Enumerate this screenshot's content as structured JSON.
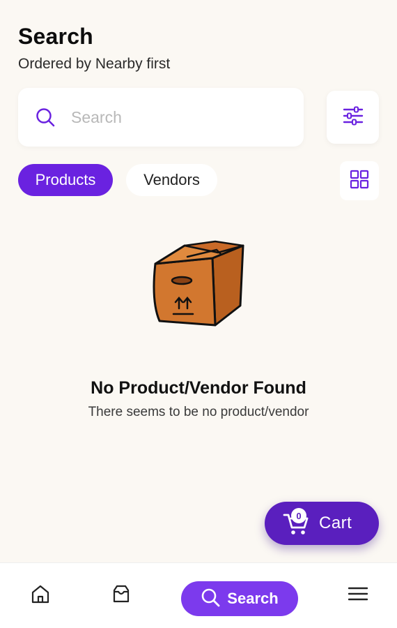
{
  "header": {
    "title": "Search",
    "subtitle": "Ordered by Nearby first"
  },
  "search": {
    "placeholder": "Search",
    "value": ""
  },
  "tabs": [
    {
      "label": "Products",
      "active": true
    },
    {
      "label": "Vendors",
      "active": false
    }
  ],
  "empty_state": {
    "title": "No Product/Vendor Found",
    "subtitle": "There seems to be no product/vendor"
  },
  "cart": {
    "label": "Cart",
    "count": "0"
  },
  "bottom_nav": {
    "search_label": "Search"
  },
  "colors": {
    "accent": "#6a22e0",
    "cart": "#5a1fbe",
    "background": "#fbf8f3",
    "box": "#d2772f"
  },
  "icons": [
    "search-icon",
    "filter-sliders-icon",
    "grid-view-icon",
    "empty-box-icon",
    "cart-icon",
    "home-icon",
    "orders-inbox-icon",
    "menu-icon"
  ]
}
